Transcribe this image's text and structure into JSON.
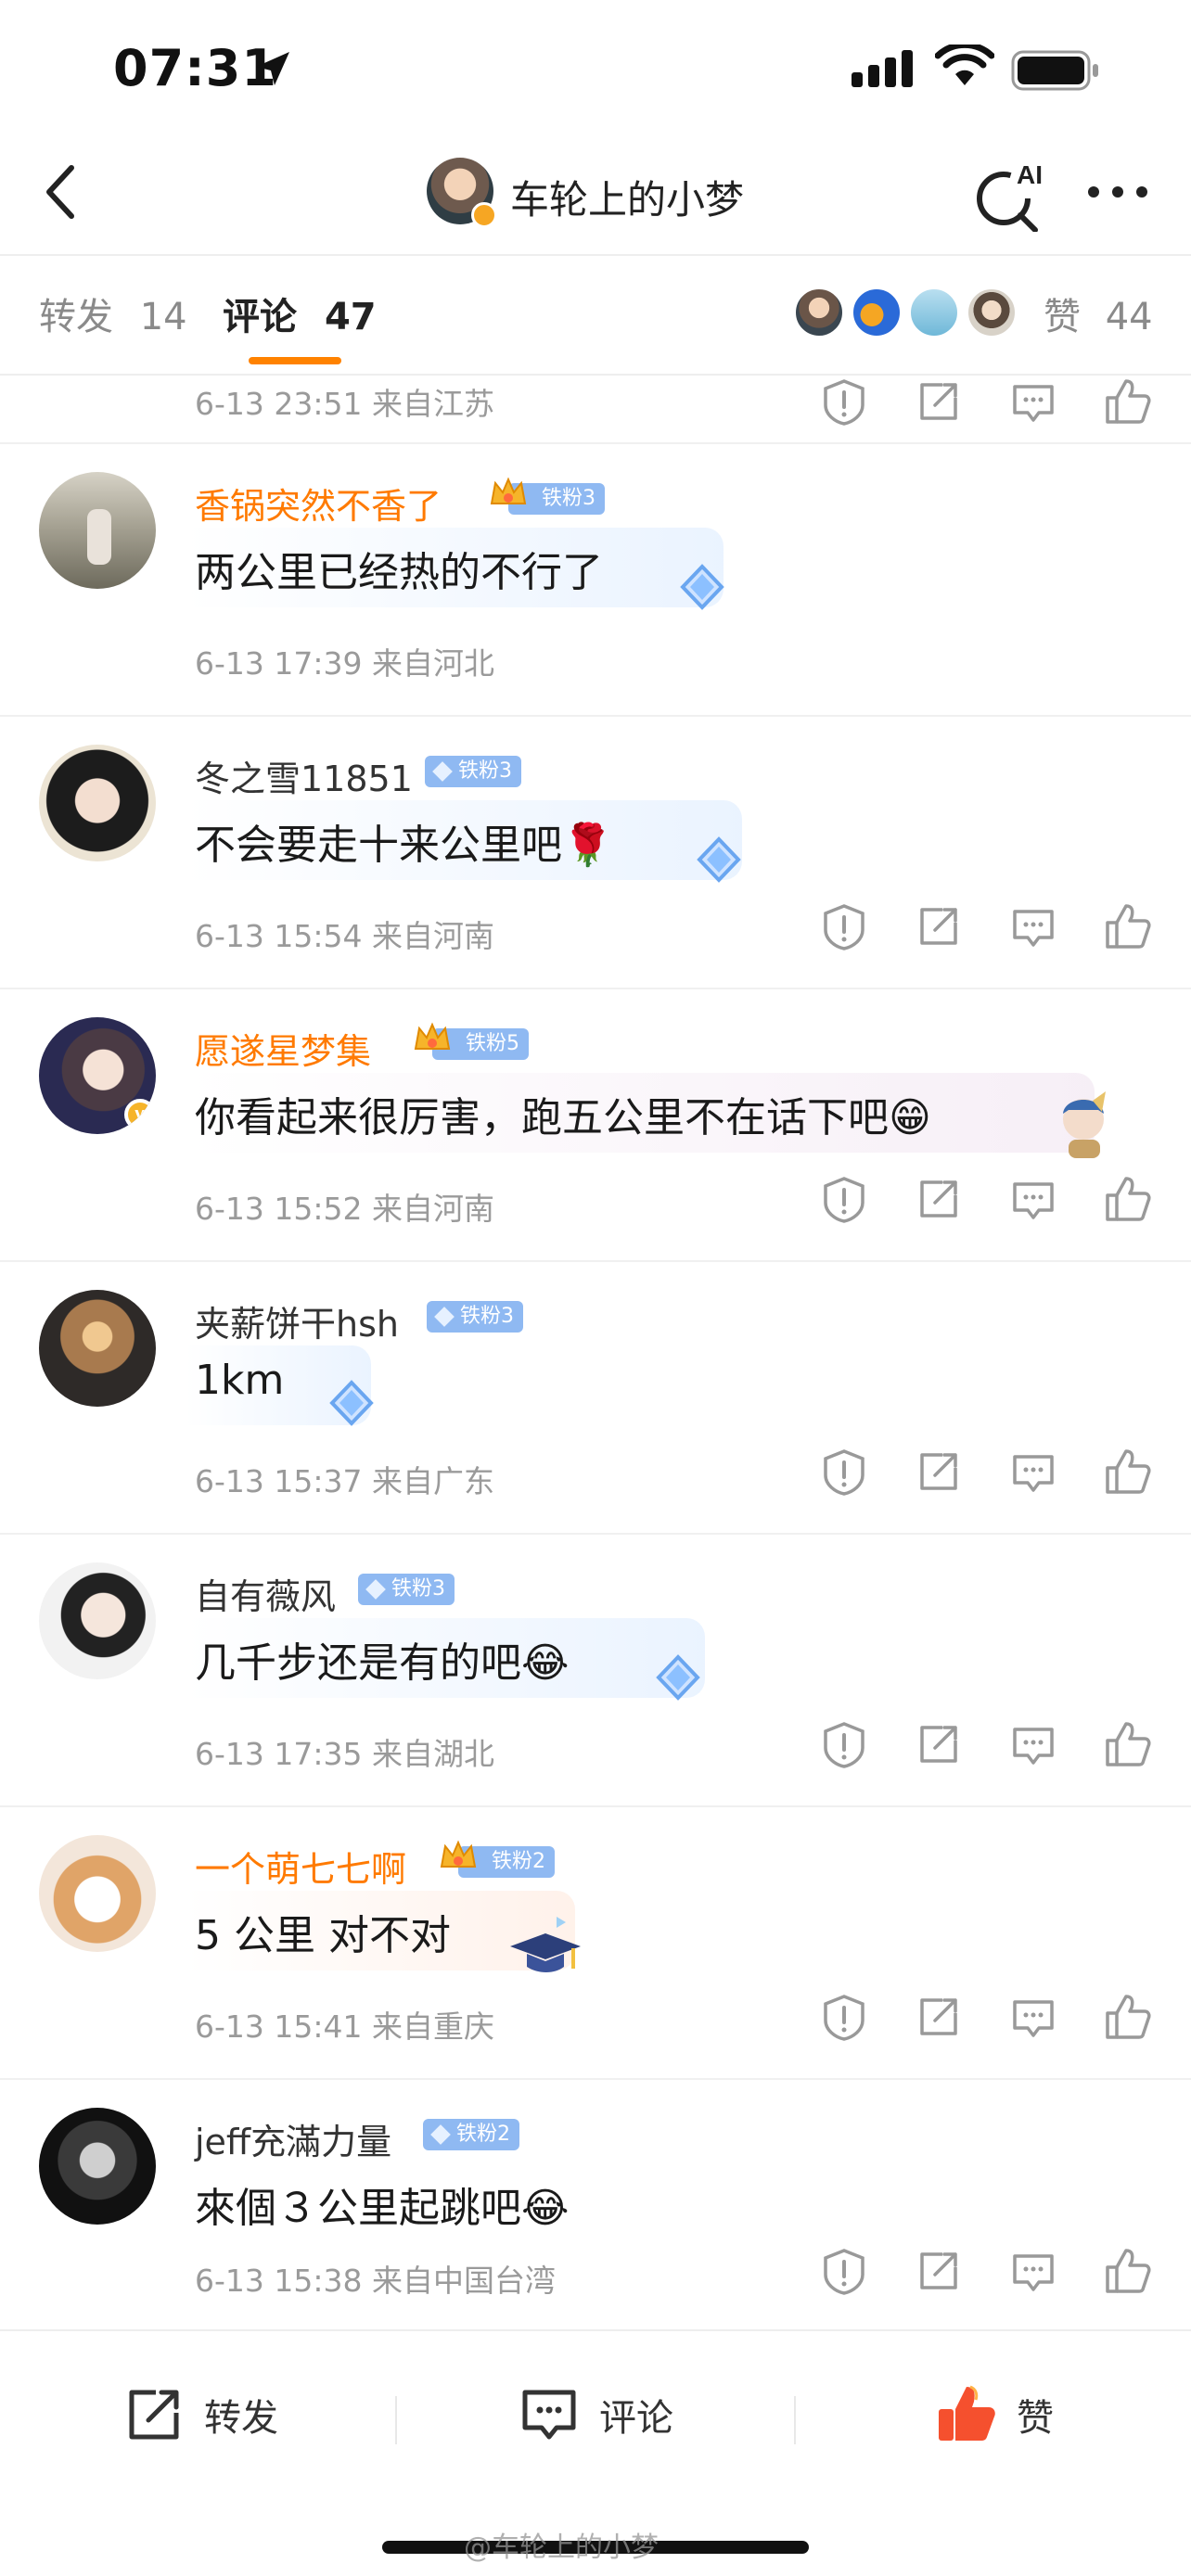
{
  "status_bar": {
    "time": "07:31"
  },
  "header": {
    "title": "车轮上的小梦",
    "ai_label": "AI"
  },
  "tabs": {
    "repost": {
      "label": "转发",
      "count": "14"
    },
    "comment": {
      "label": "评论",
      "count": "47"
    },
    "like": {
      "label": "赞",
      "count": "44"
    }
  },
  "first_partial": {
    "meta": "6-13 23:51 来自江苏"
  },
  "comments": [
    {
      "name": "香锅突然不香了",
      "badge": "铁粉3",
      "text": "两公里已经热的不行了",
      "meta": "6-13 17:39 来自河北"
    },
    {
      "name": "冬之雪11851",
      "badge": "铁粉3",
      "text": "不会要走十来公里吧🌹",
      "meta": "6-13 15:54 来自河南"
    },
    {
      "name": "愿遂星梦集",
      "badge": "铁粉5",
      "text": "你看起来很厉害，跑五公里不在话下吧😁",
      "meta": "6-13 15:52 来自河南"
    },
    {
      "name": "夹薪饼干hsh",
      "badge": "铁粉3",
      "text": "1km",
      "meta": "6-13 15:37 来自广东"
    },
    {
      "name": "自有薇风",
      "badge": "铁粉3",
      "text": "几千步还是有的吧😂",
      "meta": "6-13 17:35 来自湖北"
    },
    {
      "name": "一个萌七七啊",
      "badge": "铁粉2",
      "text": "5 公里  对不对",
      "meta": "6-13 15:41 来自重庆"
    },
    {
      "name": "jeff充滿力量",
      "badge": "铁粉2",
      "text": "來個３公里起跳吧😂",
      "meta": "6-13 15:38 来自中国台湾"
    }
  ],
  "bottom_bar": {
    "repost_label": "转发",
    "comment_label": "评论",
    "like_label": "赞"
  },
  "watermark": "@车轮上的小梦",
  "colors": {
    "accent": "#ff8200",
    "badge_blue": "#8fb9f2",
    "name_orange": "#ff7a00",
    "like_red": "#f5502e"
  }
}
